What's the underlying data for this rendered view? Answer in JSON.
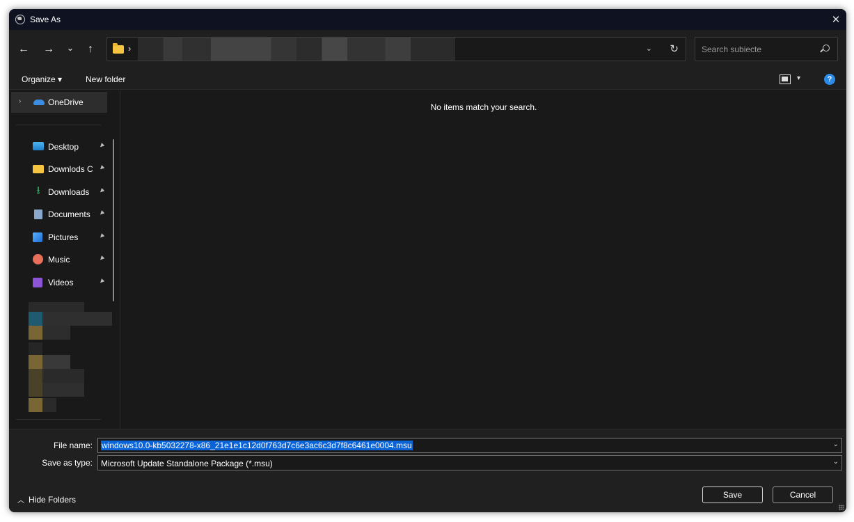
{
  "window": {
    "title": "Save As"
  },
  "nav": {
    "back": "←",
    "forward": "→",
    "recent": "⌄",
    "up": "↑",
    "breadcrumb_sep": "›",
    "address_dropdown": "⌄",
    "refresh": "↻"
  },
  "search": {
    "placeholder": "Search subiecte"
  },
  "toolbar": {
    "organize": "Organize ▾",
    "new_folder": "New folder",
    "view_caret": "▾",
    "help": "?"
  },
  "sidebar": {
    "onedrive": "OneDrive",
    "items": [
      {
        "label": "Desktop",
        "icon": "desktop-icon"
      },
      {
        "label": "Downlods C",
        "icon": "folder-icon"
      },
      {
        "label": "Downloads",
        "icon": "download-icon"
      },
      {
        "label": "Documents",
        "icon": "documents-icon"
      },
      {
        "label": "Pictures",
        "icon": "pictures-icon"
      },
      {
        "label": "Music",
        "icon": "music-icon"
      },
      {
        "label": "Videos",
        "icon": "videos-icon"
      }
    ]
  },
  "content": {
    "empty_message": "No items match your search."
  },
  "form": {
    "filename_label": "File name:",
    "filename_value": "windows10.0-kb5032278-x86_21e1e1c12d0f763d7c6e3ac6c3d7f8c6461e0004.msu",
    "type_label": "Save as type:",
    "type_value": "Microsoft Update Standalone Package (*.msu)"
  },
  "footer": {
    "hide_folders": "Hide Folders",
    "save": "Save",
    "cancel": "Cancel"
  },
  "colors": {
    "accent": "#0a64d8",
    "background": "#191919",
    "titlebar": "#0f1321"
  }
}
